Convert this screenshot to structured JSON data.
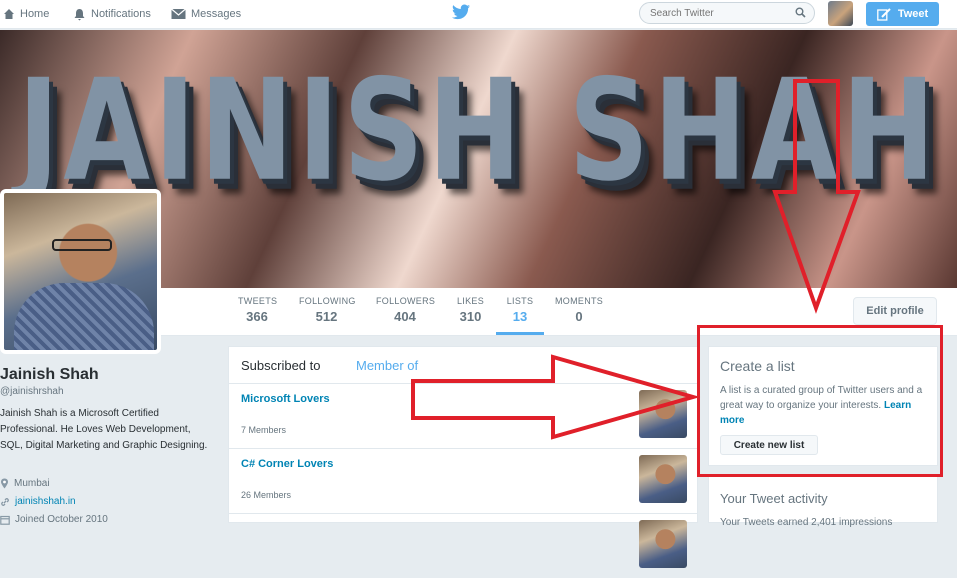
{
  "nav": {
    "home": "Home",
    "notifications": "Notifications",
    "messages": "Messages",
    "search_placeholder": "Search Twitter",
    "tweet_button": "Tweet"
  },
  "banner": {
    "text": "JAINISH SHAH"
  },
  "stats": [
    {
      "label": "TWEETS",
      "value": "366"
    },
    {
      "label": "FOLLOWING",
      "value": "512"
    },
    {
      "label": "FOLLOWERS",
      "value": "404"
    },
    {
      "label": "LIKES",
      "value": "310"
    },
    {
      "label": "LISTS",
      "value": "13"
    },
    {
      "label": "MOMENTS",
      "value": "0"
    }
  ],
  "edit_profile": "Edit profile",
  "profile": {
    "name": "Jainish Shah",
    "handle": "@jainishrshah",
    "bio": "Jainish Shah is a Microsoft Certified Professional. He Loves Web Development, SQL, Digital Marketing and Graphic Designing.",
    "location": "Mumbai",
    "website": "jainishshah.in",
    "joined": "Joined October 2010"
  },
  "lists": {
    "tab_subscribed": "Subscribed to",
    "tab_member": "Member of",
    "items": [
      {
        "name": "Microsoft Lovers",
        "members": "7 Members"
      },
      {
        "name": "C# Corner Lovers",
        "members": "26 Members"
      }
    ]
  },
  "create_list": {
    "title": "Create a list",
    "description": "A list is a curated group of Twitter users and a great way to organize your interests.",
    "learn_more": "Learn more",
    "button": "Create new list"
  },
  "activity": {
    "title": "Your Tweet activity",
    "text": "Your Tweets earned 2,401 impressions"
  },
  "colors": {
    "accent": "#55acee",
    "annotation": "#e0202a"
  }
}
